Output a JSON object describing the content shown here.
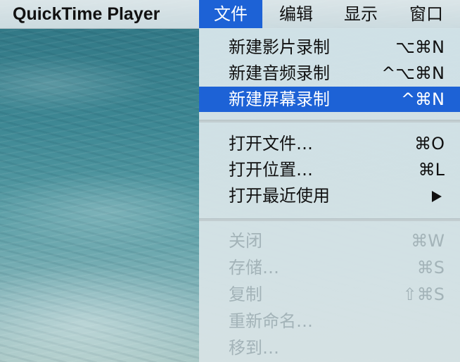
{
  "menubar": {
    "app_name": "QuickTime Player",
    "menus": [
      "文件",
      "编辑",
      "显示",
      "窗口"
    ],
    "active_menu": "文件"
  },
  "file_menu": {
    "items": [
      {
        "label": "新建影片录制",
        "shortcut": "⌥⌘N",
        "state": "enabled"
      },
      {
        "label": "新建音频录制",
        "shortcut": "^⌥⌘N",
        "state": "enabled"
      },
      {
        "label": "新建屏幕录制",
        "shortcut": "^⌘N",
        "state": "highlighted"
      },
      {
        "label": "打开文件…",
        "shortcut": "⌘O",
        "state": "enabled"
      },
      {
        "label": "打开位置…",
        "shortcut": "⌘L",
        "state": "enabled"
      },
      {
        "label": "打开最近使用",
        "shortcut": "",
        "submenu_icon": "triangle-right-icon",
        "state": "enabled"
      },
      {
        "label": "关闭",
        "shortcut": "⌘W",
        "state": "disabled"
      },
      {
        "label": "存储…",
        "shortcut": "⌘S",
        "state": "disabled"
      },
      {
        "label": "复制",
        "shortcut": "⇧⌘S",
        "state": "disabled"
      },
      {
        "label": "重新命名…",
        "shortcut": "",
        "state": "disabled"
      },
      {
        "label": "移到…",
        "shortcut": "",
        "state": "disabled"
      }
    ]
  },
  "colors": {
    "highlight": "#1d62d6",
    "disabled_text": "#a3b3b8",
    "menu_background": "#d4e4e9"
  }
}
